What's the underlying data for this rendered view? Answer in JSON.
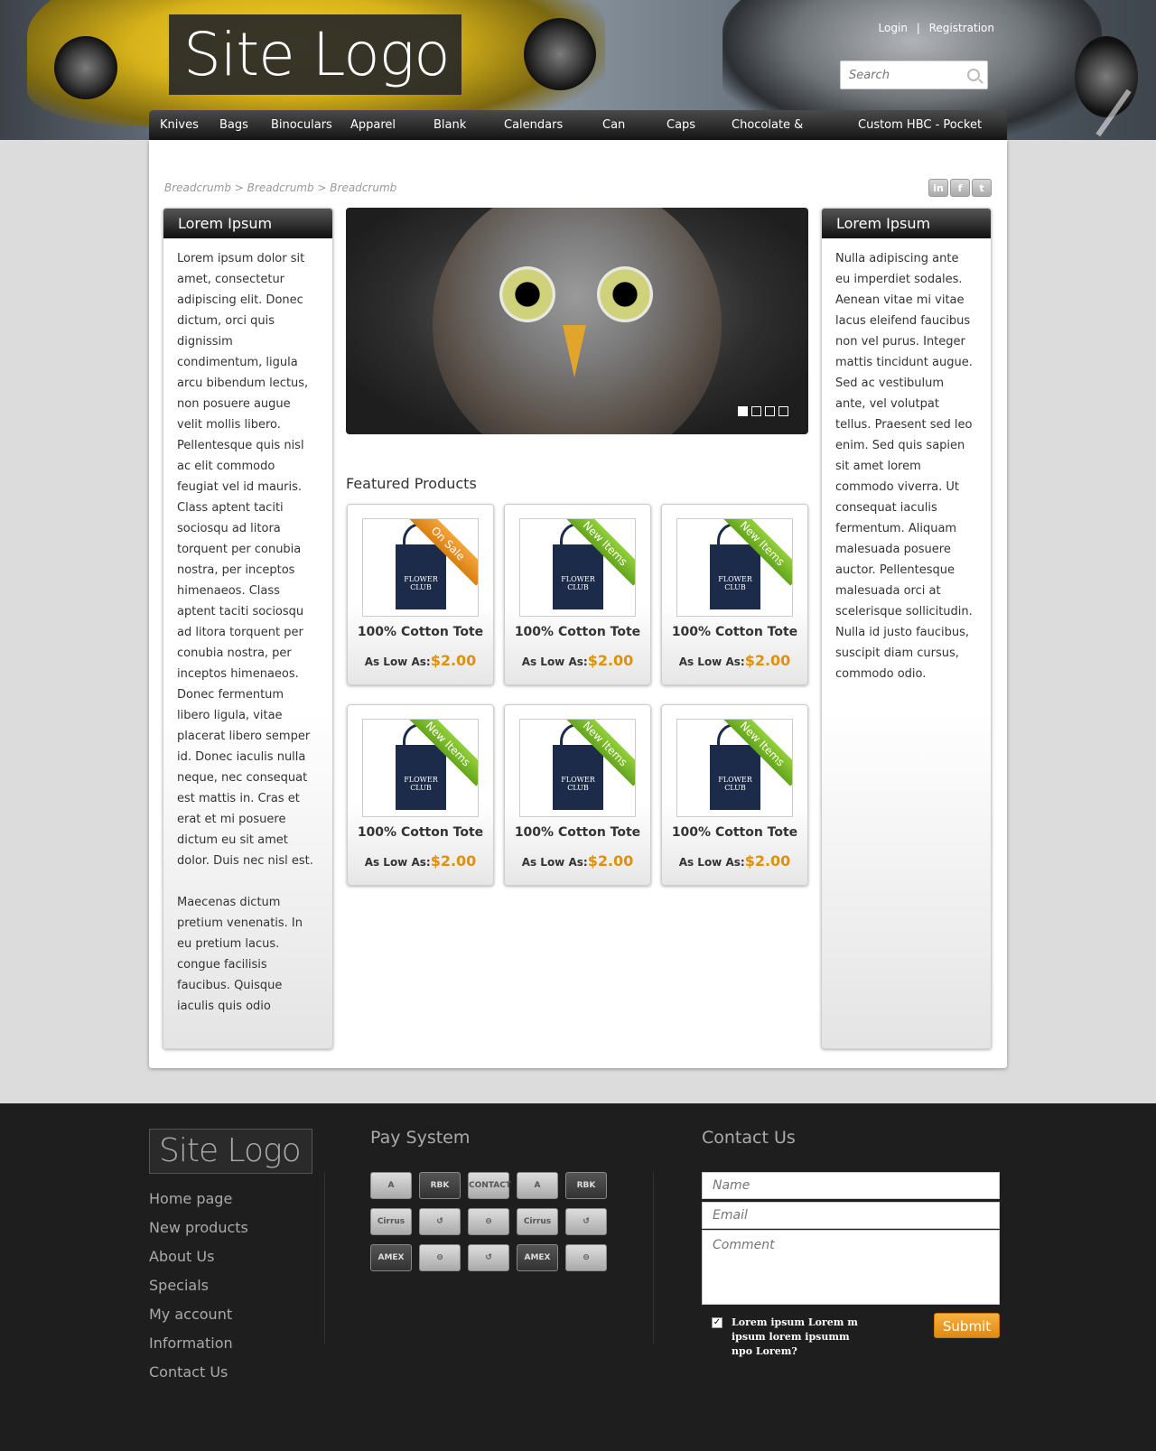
{
  "header": {
    "logo": "Site Logo",
    "login": "Login",
    "separator": "|",
    "registration": "Registration",
    "search_placeholder": "Search"
  },
  "nav": [
    "Knives",
    "Bags",
    "Binoculars",
    "Apparel",
    "Blank",
    "Calendars",
    "Can",
    "Caps",
    "Chocolate &",
    "Custom HBC - Pocket"
  ],
  "breadcrumb": "Breadcrumb > Breadcrumb > Breadcrumb",
  "social": [
    "linkedin-icon",
    "facebook-icon",
    "twitter-icon"
  ],
  "social_labels": {
    "linkedin": "in",
    "facebook": "f",
    "twitter": "t"
  },
  "left_panel": {
    "title": "Lorem Ipsum",
    "para1": "Lorem ipsum dolor sit amet, consectetur adipiscing elit. Donec dictum, orci quis dignissim condimentum, ligula arcu bibendum lectus, non posuere augue velit mollis libero. Pellentesque quis nisl ac elit commodo feugiat vel id mauris. Class aptent taciti sociosqu ad litora torquent per conubia nostra, per inceptos himenaeos. Class aptent taciti sociosqu ad litora torquent per conubia nostra, per inceptos himenaeos. Donec fermentum libero ligula, vitae placerat libero semper id. Donec iaculis nulla neque, nec consequat est mattis in. Cras et erat et mi posuere dictum eu sit amet dolor. Duis nec nisl est.",
    "para2": "Maecenas dictum pretium venenatis. In eu pretium lacus. congue facilisis faucibus. Quisque iaculis quis odio"
  },
  "right_panel": {
    "title": "Lorem Ipsum",
    "para1": "Nulla adipiscing ante eu imperdiet sodales. Aenean vitae mi vitae lacus eleifend faucibus non vel purus. Integer mattis tincidunt augue. Sed ac vestibulum ante, vel volutpat tellus. Praesent sed leo enim. Sed quis sapien sit amet lorem commodo viverra. Ut consequat iaculis fermentum. Aliquam malesuada posuere auctor. Pellentesque malesuada orci at scelerisque sollicitudin. Nulla id justo faucibus, suscipit diam cursus, commodo odio."
  },
  "slider": {
    "slide_count": 4,
    "active_slide": 1
  },
  "featured": {
    "title": "Featured Products",
    "products": [
      {
        "name": "100% Cotton Tote",
        "price_label": "As Low As:",
        "price": "$2.00",
        "badge": "On Sale",
        "badge_type": "sale",
        "bag_text": "FLOWER CLUB"
      },
      {
        "name": "100% Cotton Tote",
        "price_label": "As Low As:",
        "price": "$2.00",
        "badge": "New Items",
        "badge_type": "new",
        "bag_text": "FLOWER CLUB"
      },
      {
        "name": "100% Cotton Tote",
        "price_label": "As Low As:",
        "price": "$2.00",
        "badge": "New Items",
        "badge_type": "new",
        "bag_text": "FLOWER CLUB"
      },
      {
        "name": "100% Cotton Tote",
        "price_label": "As Low As:",
        "price": "$2.00",
        "badge": "New Items",
        "badge_type": "new",
        "bag_text": "FLOWER CLUB"
      },
      {
        "name": "100% Cotton Tote",
        "price_label": "As Low As:",
        "price": "$2.00",
        "badge": "New Items",
        "badge_type": "new",
        "bag_text": "FLOWER CLUB"
      },
      {
        "name": "100% Cotton Tote",
        "price_label": "As Low As:",
        "price": "$2.00",
        "badge": "New Items",
        "badge_type": "new",
        "bag_text": "FLOWER CLUB"
      }
    ]
  },
  "footer": {
    "logo": "Site Logo",
    "links": [
      "Home page",
      "New products",
      "About Us",
      "Specials",
      "My account",
      "Information",
      "Contact Us"
    ],
    "pay_title": "Pay System",
    "pay_icons": [
      {
        "label": "A",
        "style": "light"
      },
      {
        "label": "RBK",
        "style": "dark"
      },
      {
        "label": "CONTACT",
        "style": "light"
      },
      {
        "label": "A",
        "style": "light"
      },
      {
        "label": "RBK",
        "style": "dark"
      },
      {
        "label": "Cirrus",
        "style": "light"
      },
      {
        "label": "↺",
        "style": "light"
      },
      {
        "label": "⊖",
        "style": "light"
      },
      {
        "label": "Cirrus",
        "style": "light"
      },
      {
        "label": "↺",
        "style": "light"
      },
      {
        "label": "AMEX",
        "style": "dark"
      },
      {
        "label": "⊖",
        "style": "light"
      },
      {
        "label": "↺",
        "style": "light"
      },
      {
        "label": "AMEX",
        "style": "dark"
      },
      {
        "label": "⊖",
        "style": "light"
      }
    ],
    "contact_title": "Contact Us",
    "name_placeholder": "Name",
    "email_placeholder": "Email",
    "comment_placeholder": "Comment",
    "check_mark": "✓",
    "checkbox_label": "Lorem ipsum Lorem m ipsum lorem ipsumm npo Lorem?",
    "submit": "Submit"
  },
  "colors": {
    "accent_orange": "#e0900a",
    "ribbon_green": "#7cc02c",
    "ribbon_orange": "#e8901c",
    "footer_bg": "#1e1e1e"
  }
}
